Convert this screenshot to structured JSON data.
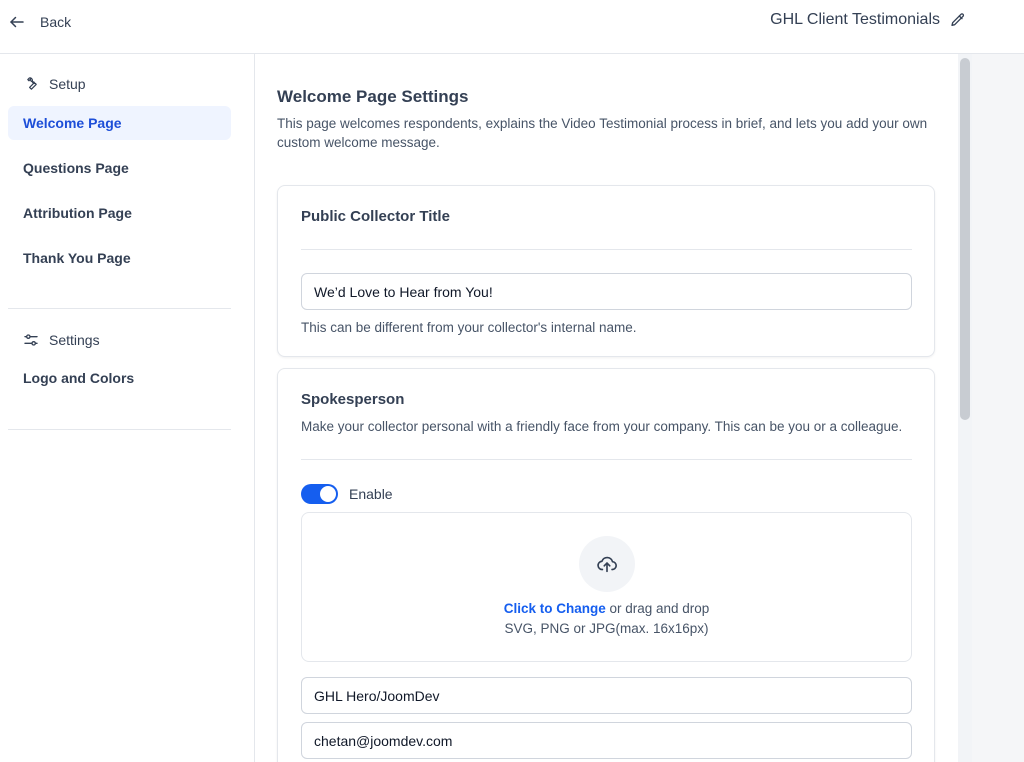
{
  "header": {
    "back_label": "Back",
    "app_title": "GHL Client Testimonials"
  },
  "sidebar": {
    "setup_label": "Setup",
    "setup_items": [
      {
        "label": "Welcome Page",
        "active": true
      },
      {
        "label": "Questions Page",
        "active": false
      },
      {
        "label": "Attribution Page",
        "active": false
      },
      {
        "label": "Thank You Page",
        "active": false
      }
    ],
    "settings_label": "Settings",
    "settings_items": [
      {
        "label": "Logo and Colors",
        "active": false
      }
    ]
  },
  "main": {
    "title": "Welcome Page Settings",
    "description": "This page welcomes respondents, explains the Video Testimonial process in brief, and lets you add your own custom welcome message.",
    "collector_card": {
      "title": "Public Collector Title",
      "input_value": "We’d Love to Hear from You!",
      "help_text": "This can be different from your collector's internal name."
    },
    "spokesperson_card": {
      "title": "Spokesperson",
      "subtitle": "Make your collector personal with a friendly face from your company. This can be you or a colleague.",
      "toggle_label": "Enable",
      "toggle_on": true,
      "upload": {
        "link_text": "Click to Change",
        "rest_text": " or drag and drop",
        "formats": "SVG, PNG or JPG(max. 16x16px)"
      },
      "name_value": "GHL Hero/JoomDev",
      "email_value": "chetan@joomdev.com"
    }
  },
  "colors": {
    "accent": "#155eef",
    "active_nav_bg": "#eff4ff",
    "active_nav_text": "#1d4ed8",
    "border": "#e4e7ec"
  },
  "icons": {
    "back": "arrow-left-icon",
    "edit": "pencil-icon",
    "setup": "wrench-icon",
    "settings": "sliders-icon",
    "upload": "cloud-upload-icon"
  }
}
